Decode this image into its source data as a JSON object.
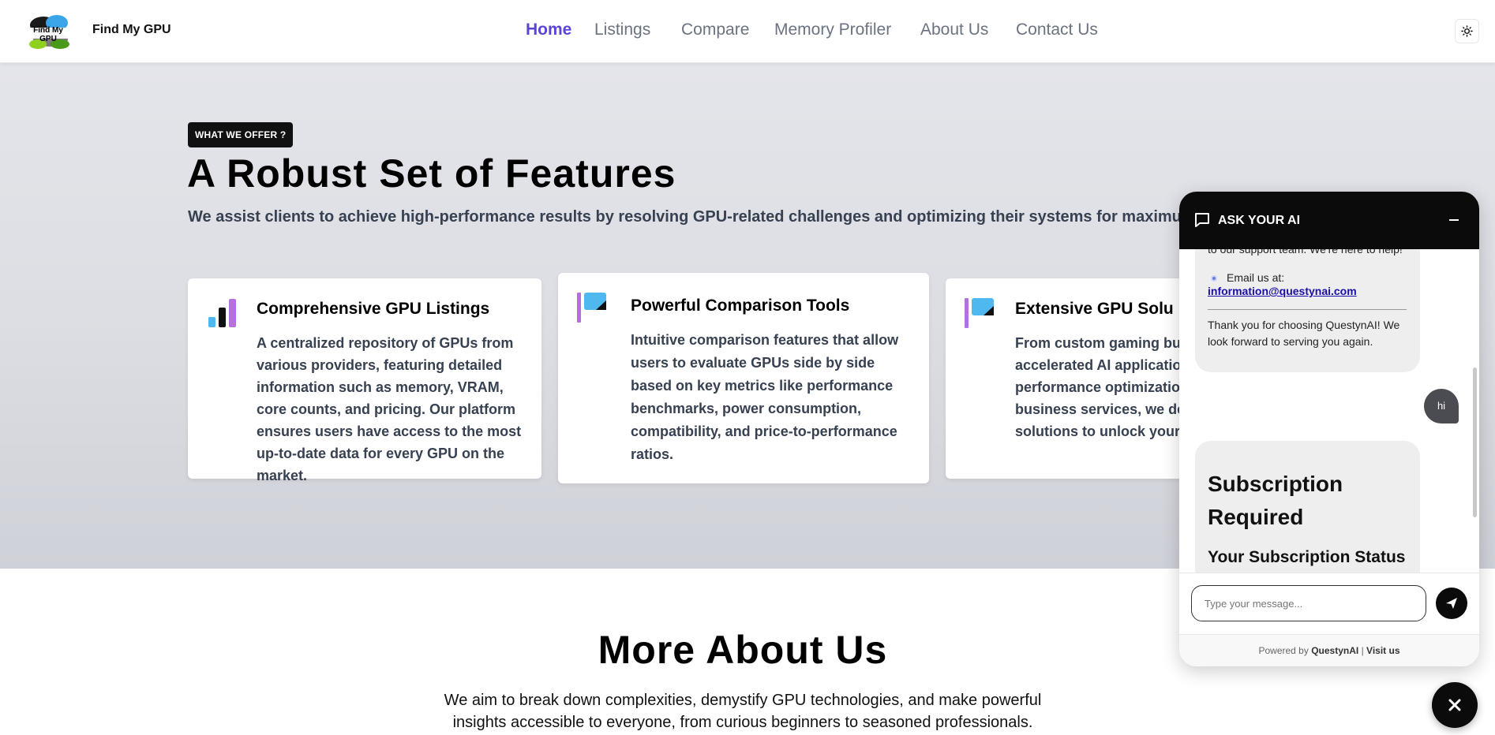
{
  "nav": {
    "brand": "Find My GPU",
    "logo_text": "Find My GPU",
    "links": [
      {
        "label": "Home",
        "active": true
      },
      {
        "label": "Listings",
        "active": false
      },
      {
        "label": "Compare",
        "active": false
      },
      {
        "label": "Memory Profiler",
        "active": false
      },
      {
        "label": "About Us",
        "active": false
      },
      {
        "label": "Contact Us",
        "active": false
      }
    ],
    "theme_icon": "sun-icon"
  },
  "features": {
    "badge": "WHAT WE OFFER ?",
    "headline": "A Robust Set of Features",
    "subline": "We assist clients to achieve high-performance results by resolving GPU-related challenges and optimizing their systems for maximu",
    "cards": [
      {
        "icon": "bar-chart-icon",
        "title": "Comprehensive GPU Listings",
        "text": "A centralized repository of GPUs from various providers, featuring detailed information such as memory, VRAM, core counts, and pricing. Our platform ensures users have access to the most up-to-date data for every GPU on the market."
      },
      {
        "icon": "flag-icon",
        "title": "Powerful Comparison Tools",
        "text": "Intuitive comparison features that allow users to evaluate GPUs side by side based on key metrics like performance benchmarks, power consumption, compatibility, and price-to-performance ratios."
      },
      {
        "icon": "flag-icon",
        "title": "Extensive GPU Solu",
        "text": "From custom gaming bu accelerated AI applicatio performance optimizatio business services, we de solutions to unlock your"
      }
    ]
  },
  "about": {
    "title": "More About Us",
    "text": "We aim to break down complexities, demystify GPU technologies, and make powerful insights accessible to everyone, from curious beginners to seasoned professionals."
  },
  "chat": {
    "title": "ASK YOUR AI",
    "partial_line": "to our support team. We're here to help!",
    "email_label": "Email us at:",
    "email": "information@questynai.com",
    "thanks": "Thank you for choosing QuestynAI! We look forward to serving you again.",
    "user_message": "hi",
    "sub_title": "Subscription Required",
    "sub_status": "Your Subscription Status",
    "input_placeholder": "Type your message...",
    "footer_prefix": "Powered by",
    "footer_brand": "QuestynAI",
    "footer_sep": "|",
    "footer_link": "Visit us"
  },
  "colors": {
    "accent": "#5b45d6",
    "icon_purple": "#b66fe0",
    "icon_blue": "#4fb8ee",
    "dark": "#0b0b0b"
  }
}
